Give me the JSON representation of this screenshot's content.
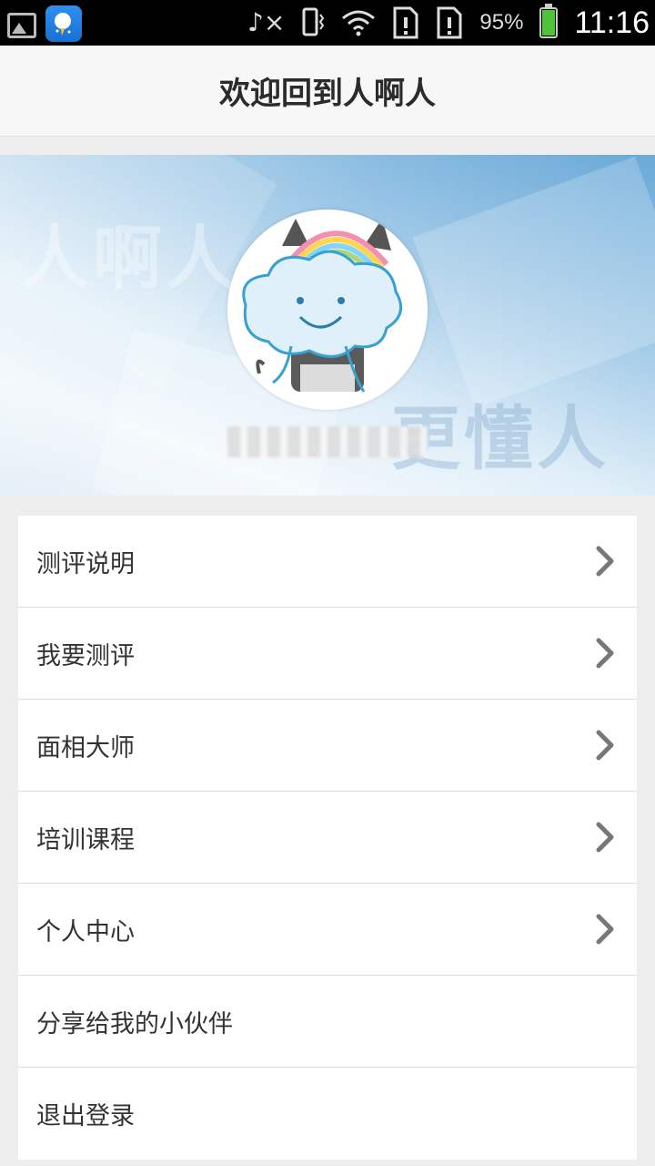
{
  "status_bar": {
    "battery_percent": "95%",
    "battery_level": 0.95,
    "time": "11:16",
    "icons": [
      "image-icon",
      "weather-app-icon",
      "music-muted-icon",
      "vibrate-icon",
      "wifi-icon",
      "sim-alert-icon",
      "sim-alert-icon"
    ]
  },
  "header": {
    "title": "欢迎回到人啊人"
  },
  "banner": {
    "watermark_left": "人啊人",
    "watermark_right": "更懂人",
    "username_blurred": true
  },
  "menu": {
    "items": [
      {
        "label": "测评说明",
        "has_chevron": true
      },
      {
        "label": "我要测评",
        "has_chevron": true
      },
      {
        "label": "面相大师",
        "has_chevron": true
      },
      {
        "label": "培训课程",
        "has_chevron": true
      },
      {
        "label": "个人中心",
        "has_chevron": true
      },
      {
        "label": "分享给我的小伙伴",
        "has_chevron": false
      },
      {
        "label": "退出登录",
        "has_chevron": false
      }
    ]
  },
  "colors": {
    "status_bar_bg": "#000000",
    "header_bg": "#f7f7f7",
    "page_bg": "#eeeeee",
    "menu_bg": "#ffffff",
    "chevron": "#777777",
    "battery_green": "#4fc23a"
  }
}
